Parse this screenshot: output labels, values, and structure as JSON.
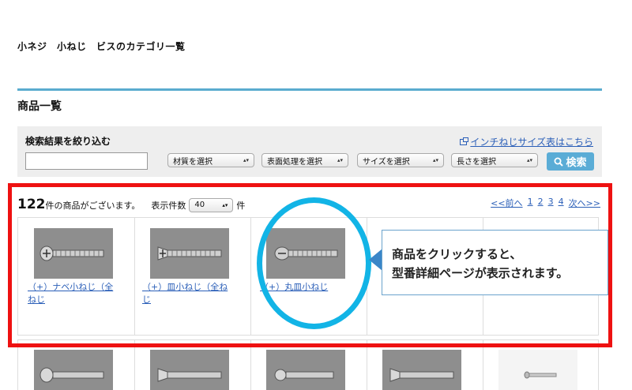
{
  "category_title": "小ネジ　小ねじ　ビスのカテゴリ一覧",
  "section_title": "商品一覧",
  "filter": {
    "label": "検索結果を絞り込む",
    "inch_link": "インチねじサイズ表はこちら",
    "material": "材質を選択",
    "surface": "表面処理を選択",
    "size": "サイズを選択",
    "length": "長さを選択",
    "search_button": "検索"
  },
  "results": {
    "count": "122",
    "count_suffix": "件の商品がございます。",
    "per_page_label": "表示件数",
    "per_page_value": "40",
    "per_page_unit": "件"
  },
  "pager": {
    "prev": "<<前へ",
    "pages": [
      "1",
      "2",
      "3",
      "4"
    ],
    "next": "次へ>>"
  },
  "products": [
    {
      "name_line1": "（+）ナベ小ねじ（全",
      "name_line2": "ねじ"
    },
    {
      "name_line1": "（+）皿小ねじ（全ね",
      "name_line2": "じ"
    },
    {
      "name_line1": "（+）丸皿小ねじ",
      "name_line2": ""
    }
  ],
  "callout": {
    "line1": "商品をクリックすると、",
    "line2": "型番詳細ページが表示されます。"
  },
  "colors": {
    "accent_blue": "#5aaccf",
    "highlight_red": "#ee1111",
    "highlight_cyan": "#12b4e6",
    "link": "#2b5fb8"
  },
  "icons": [
    "external-link-icon",
    "search-icon",
    "dropdown-arrow-icon",
    "screw-image"
  ]
}
